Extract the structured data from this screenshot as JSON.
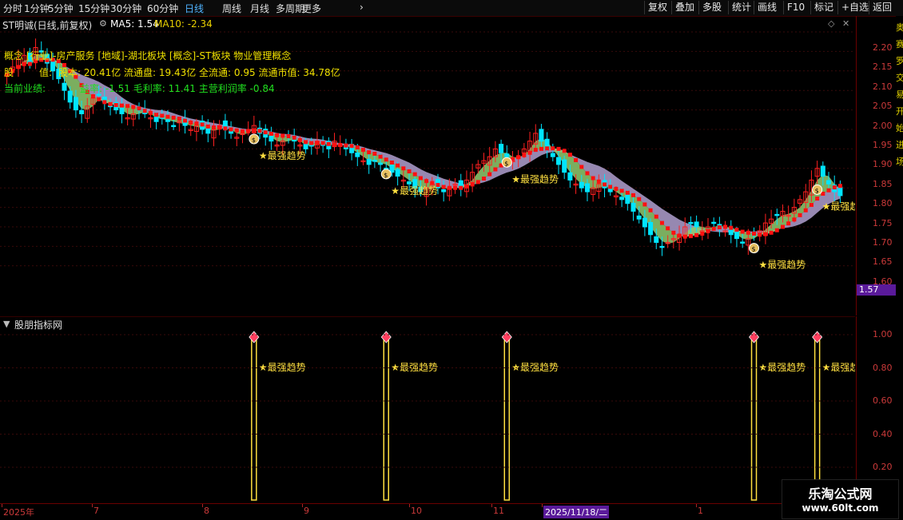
{
  "toolbar": {
    "periods": [
      "分时",
      "1分钟",
      "5分钟",
      "15分钟",
      "30分钟",
      "60分钟",
      "日线",
      "周线",
      "月线",
      "多周期",
      "更多"
    ],
    "active_period": "日线",
    "right_buttons": [
      "复权",
      "叠加",
      "多股",
      "统计",
      "画线",
      "F10",
      "标记",
      "+自选",
      "返回"
    ]
  },
  "main_panel": {
    "title": "ST明诚(日线,前复权)",
    "ma5": "MA5: 1.54",
    "ma10": "MA10: -2.34",
    "info_line1": "概念 [行业]-房产服务 [地域]-湖北板块 [概念]-ST板块 物业管理概念",
    "info_line2_prefix": "股",
    "info_line2_middle": "值:",
    "info_line2": "股本: 20.41亿 流通盘: 19.43亿 全流通: 0.95 流通市值: 34.78亿",
    "info_line3_prefix": "当前业绩:",
    "info_line3": "益率: -1.51 毛利率: 11.41 主营利润率 -0.84",
    "signal_label": "★最强趋势",
    "y_ticks": [
      "2.20",
      "2.15",
      "2.10",
      "2.05",
      "2.00",
      "1.95",
      "1.90",
      "1.85",
      "1.80",
      "1.75",
      "1.70",
      "1.65",
      "1.60"
    ],
    "price_tag": "1.57",
    "colors": {
      "up": "#ff2020",
      "down": "#00e5ff",
      "ma_fast": "#e8d000",
      "ma_band_a": "#b0a0d0",
      "ma_band_b": "#90cc70",
      "trend": "#ff1010",
      "signal": "#ffe040"
    }
  },
  "indicator_panel": {
    "title": "股朋指标网",
    "signal_label": "★最强趋势",
    "y_ticks": [
      "1.00",
      "0.80",
      "0.60",
      "0.40",
      "0.20"
    ]
  },
  "x_axis": {
    "labels": [
      "2025年",
      "7",
      "8",
      "9",
      "10",
      "11",
      "2025/11/18/二",
      "1"
    ]
  },
  "right_strip_text": "奥赛罗交易开始进场",
  "watermark": {
    "title": "乐淘公式网",
    "url": "www.60lt.com"
  },
  "chart_data": {
    "type": "candlestick",
    "ylim": [
      1.6,
      2.24
    ],
    "closes": [
      2.09,
      2.11,
      2.13,
      2.14,
      2.12,
      2.16,
      2.15,
      2.12,
      2.1,
      2.08,
      2.05,
      2.02,
      2.0,
      1.99,
      2.01,
      2.03,
      2.04,
      2.02,
      2.01,
      2.0,
      1.99,
      1.98,
      1.99,
      2.0,
      1.99,
      1.98,
      1.97,
      1.98,
      1.97,
      1.96,
      1.97,
      1.96,
      1.95,
      1.96,
      1.95,
      1.94,
      1.95,
      1.96,
      1.95,
      1.94,
      1.93,
      1.94,
      1.95,
      1.96,
      1.94,
      1.93,
      1.92,
      1.91,
      1.92,
      1.93,
      1.92,
      1.91,
      1.9,
      1.91,
      1.92,
      1.91,
      1.9,
      1.92,
      1.91,
      1.9,
      1.89,
      1.88,
      1.87,
      1.86,
      1.87,
      1.86,
      1.85,
      1.84,
      1.83,
      1.82,
      1.81,
      1.8,
      1.79,
      1.8,
      1.81,
      1.8,
      1.79,
      1.8,
      1.81,
      1.8,
      1.82,
      1.84,
      1.86,
      1.87,
      1.88,
      1.9,
      1.89,
      1.88,
      1.87,
      1.88,
      1.9,
      1.92,
      1.94,
      1.92,
      1.9,
      1.88,
      1.86,
      1.84,
      1.82,
      1.81,
      1.8,
      1.79,
      1.8,
      1.81,
      1.8,
      1.79,
      1.78,
      1.77,
      1.76,
      1.74,
      1.72,
      1.7,
      1.68,
      1.66,
      1.65,
      1.66,
      1.67,
      1.68,
      1.7,
      1.71,
      1.7,
      1.69,
      1.7,
      1.71,
      1.7,
      1.69,
      1.68,
      1.67,
      1.66,
      1.67,
      1.68,
      1.69,
      1.71,
      1.72,
      1.73,
      1.74,
      1.73,
      1.75,
      1.77,
      1.79,
      1.82,
      1.85,
      1.83,
      1.81,
      1.79,
      1.78
    ],
    "signals_index": [
      43,
      66,
      87,
      130,
      141
    ]
  }
}
